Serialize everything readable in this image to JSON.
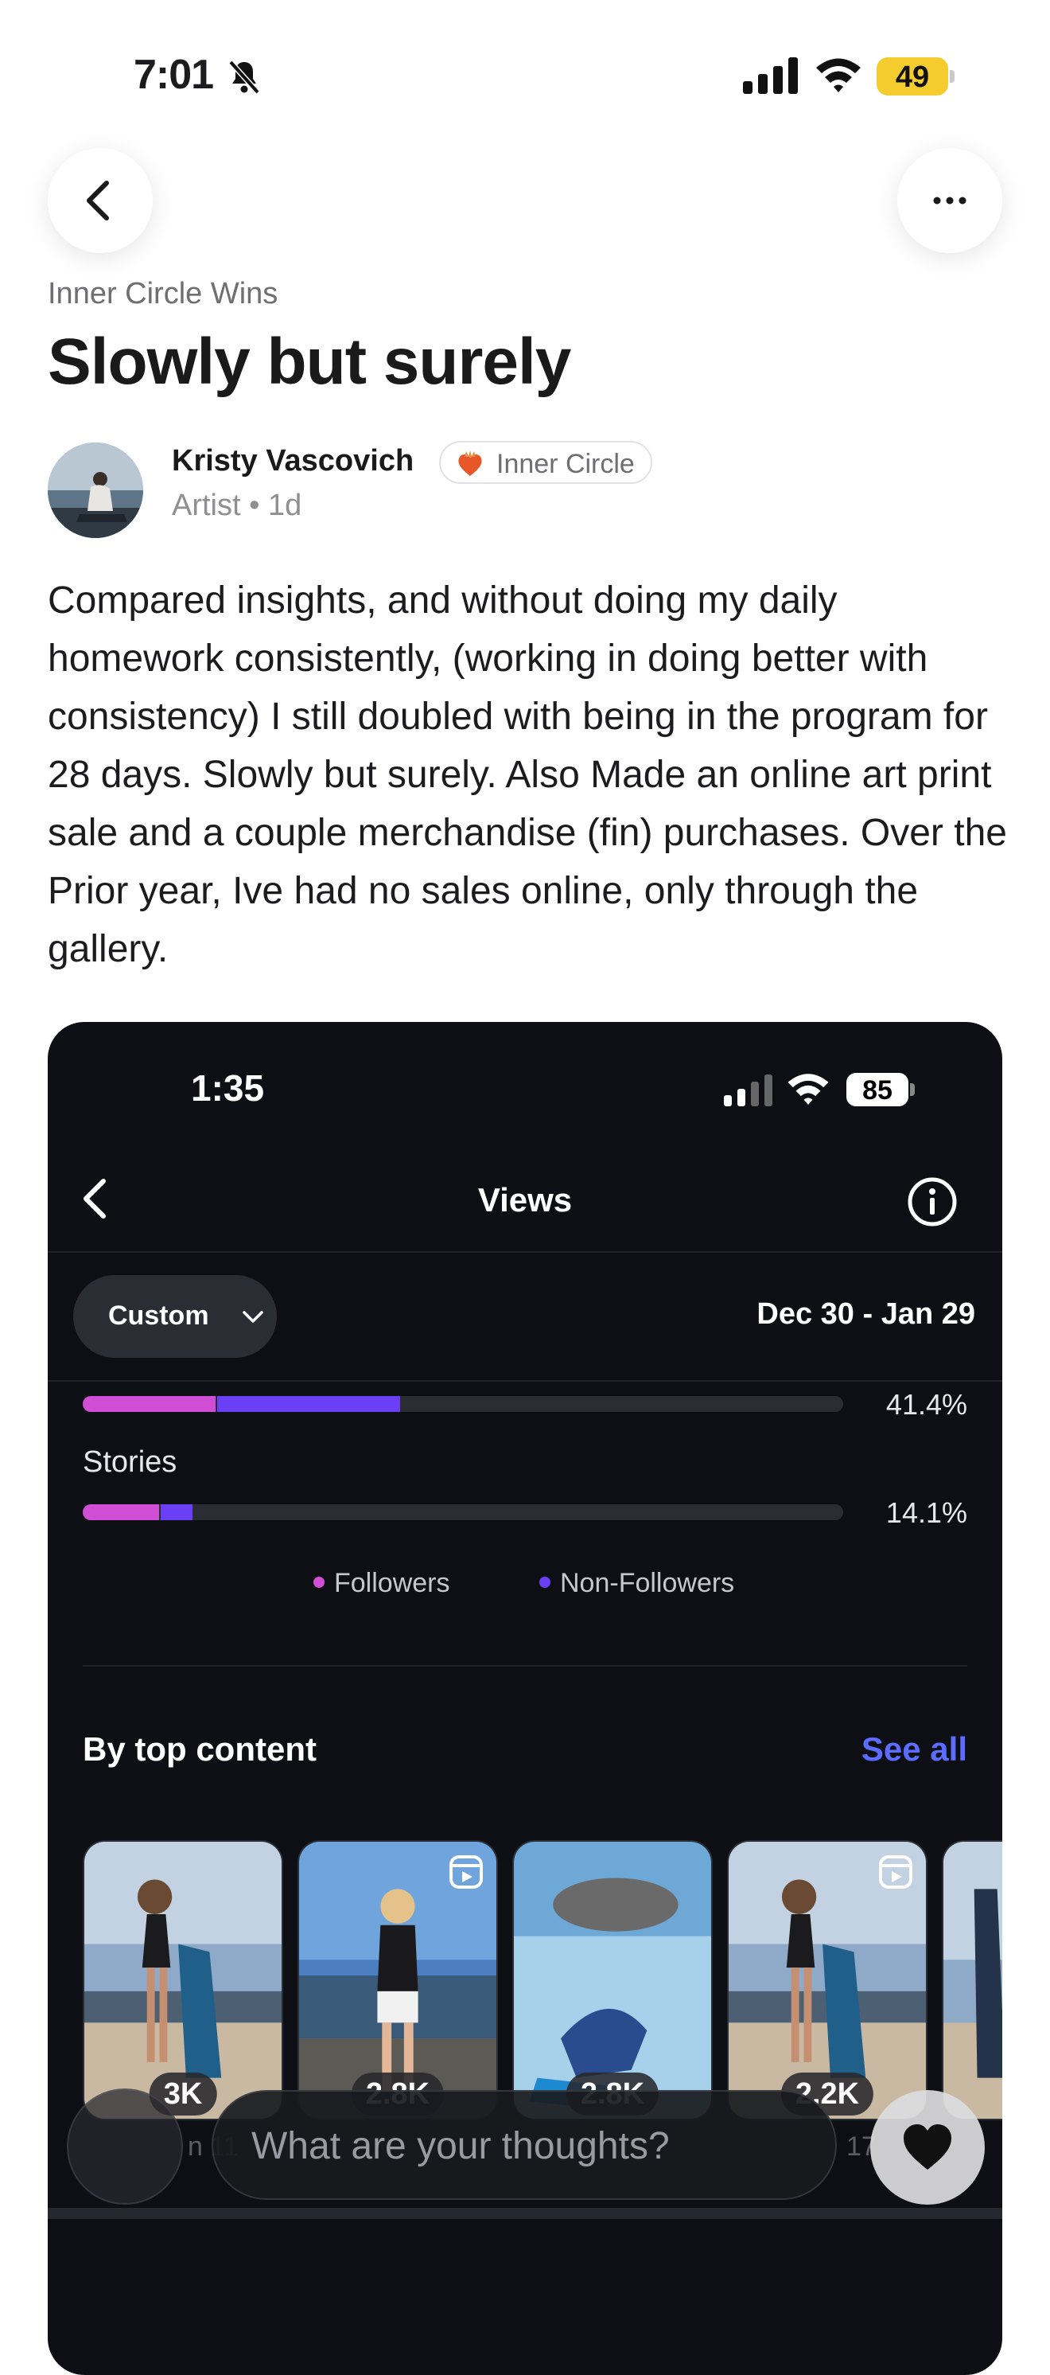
{
  "status_bar": {
    "time": "7:01",
    "battery": "49"
  },
  "post": {
    "category": "Inner Circle Wins",
    "title": "Slowly but surely",
    "author": {
      "name": "Kristy Vascovich",
      "badge": "Inner Circle",
      "role": "Artist",
      "age": "1d"
    },
    "body": "Compared insights, and without doing my daily homework consistently, (working in doing better with consistency) I still doubled with being in the program for 28 days. Slowly but surely. Also Made an online art print sale and a couple merchandise (fin) purchases. Over the Prior year, Ive had no sales online, only through the gallery."
  },
  "embedded_screenshot": {
    "status_time": "1:35",
    "battery": "85",
    "title": "Views",
    "filter_label": "Custom",
    "date_range": "Dec 30 - Jan 29",
    "rows": [
      {
        "label": "",
        "followers_fraction": 0.175,
        "non_followers_fraction": 0.24,
        "percent": "41.4%"
      },
      {
        "label": "Stories",
        "followers_fraction": 0.1,
        "non_followers_fraction": 0.042,
        "percent": "14.1%"
      }
    ],
    "legend": {
      "followers": "Followers",
      "non_followers": "Non-Followers"
    },
    "colors": {
      "followers": "#d04ed6",
      "non_followers": "#6a3ff5",
      "link": "#5b6cff"
    },
    "section_title": "By top content",
    "see_all": "See all",
    "thumbnails": [
      {
        "views": "3K",
        "reel": false
      },
      {
        "views": "2.8K",
        "reel": true
      },
      {
        "views": "2.8K",
        "reel": false
      },
      {
        "views": "2.2K",
        "reel": true
      }
    ],
    "partial_dates": [
      "n 11",
      "17"
    ]
  },
  "composer": {
    "placeholder": "What are your thoughts?"
  }
}
